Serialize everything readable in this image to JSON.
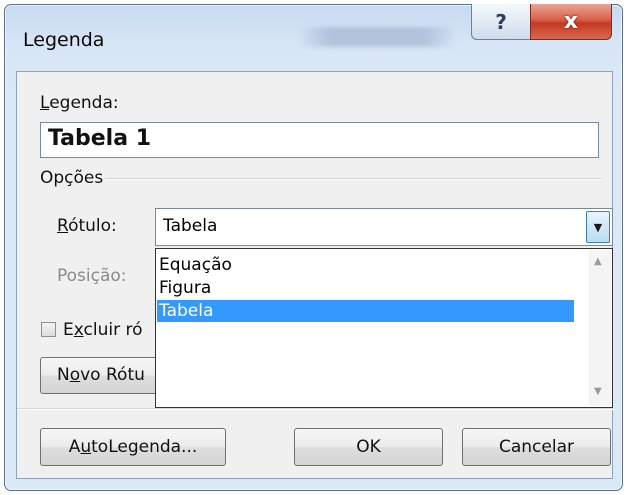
{
  "dialog": {
    "title": "Legenda",
    "caption_label_prefix": "L",
    "caption_label_rest": "egenda:",
    "caption_value": "Tabela 1",
    "options_group": "Opções",
    "label_prefix": "R",
    "label_rest": "ótulo:",
    "label_value": "Tabela",
    "position_label": "Posição:",
    "exclude_prefix": "E",
    "exclude_hotkey": "x",
    "exclude_rest": "cluir ró",
    "new_label_prefix": "N",
    "new_label_hotkey": "o",
    "new_label_rest": "vo Rótu",
    "label_options": [
      "Equação",
      "Figura",
      "Tabela"
    ],
    "selected_option": "Tabela",
    "autocaption_prefix": "A",
    "autocaption_hotkey": "u",
    "autocaption_rest": "toLegenda...",
    "ok_label": "OK",
    "cancel_label": "Cancelar"
  },
  "titlebar": {
    "help_glyph": "?",
    "close_glyph": "x"
  },
  "colors": {
    "selection": "#3399ff",
    "close_button": "#c23a22",
    "titlebar": "#c7daf0"
  },
  "icons": [
    "help-icon",
    "close-icon",
    "dropdown-arrow-icon",
    "scroll-up-icon",
    "scroll-down-icon",
    "checkbox-icon"
  ]
}
